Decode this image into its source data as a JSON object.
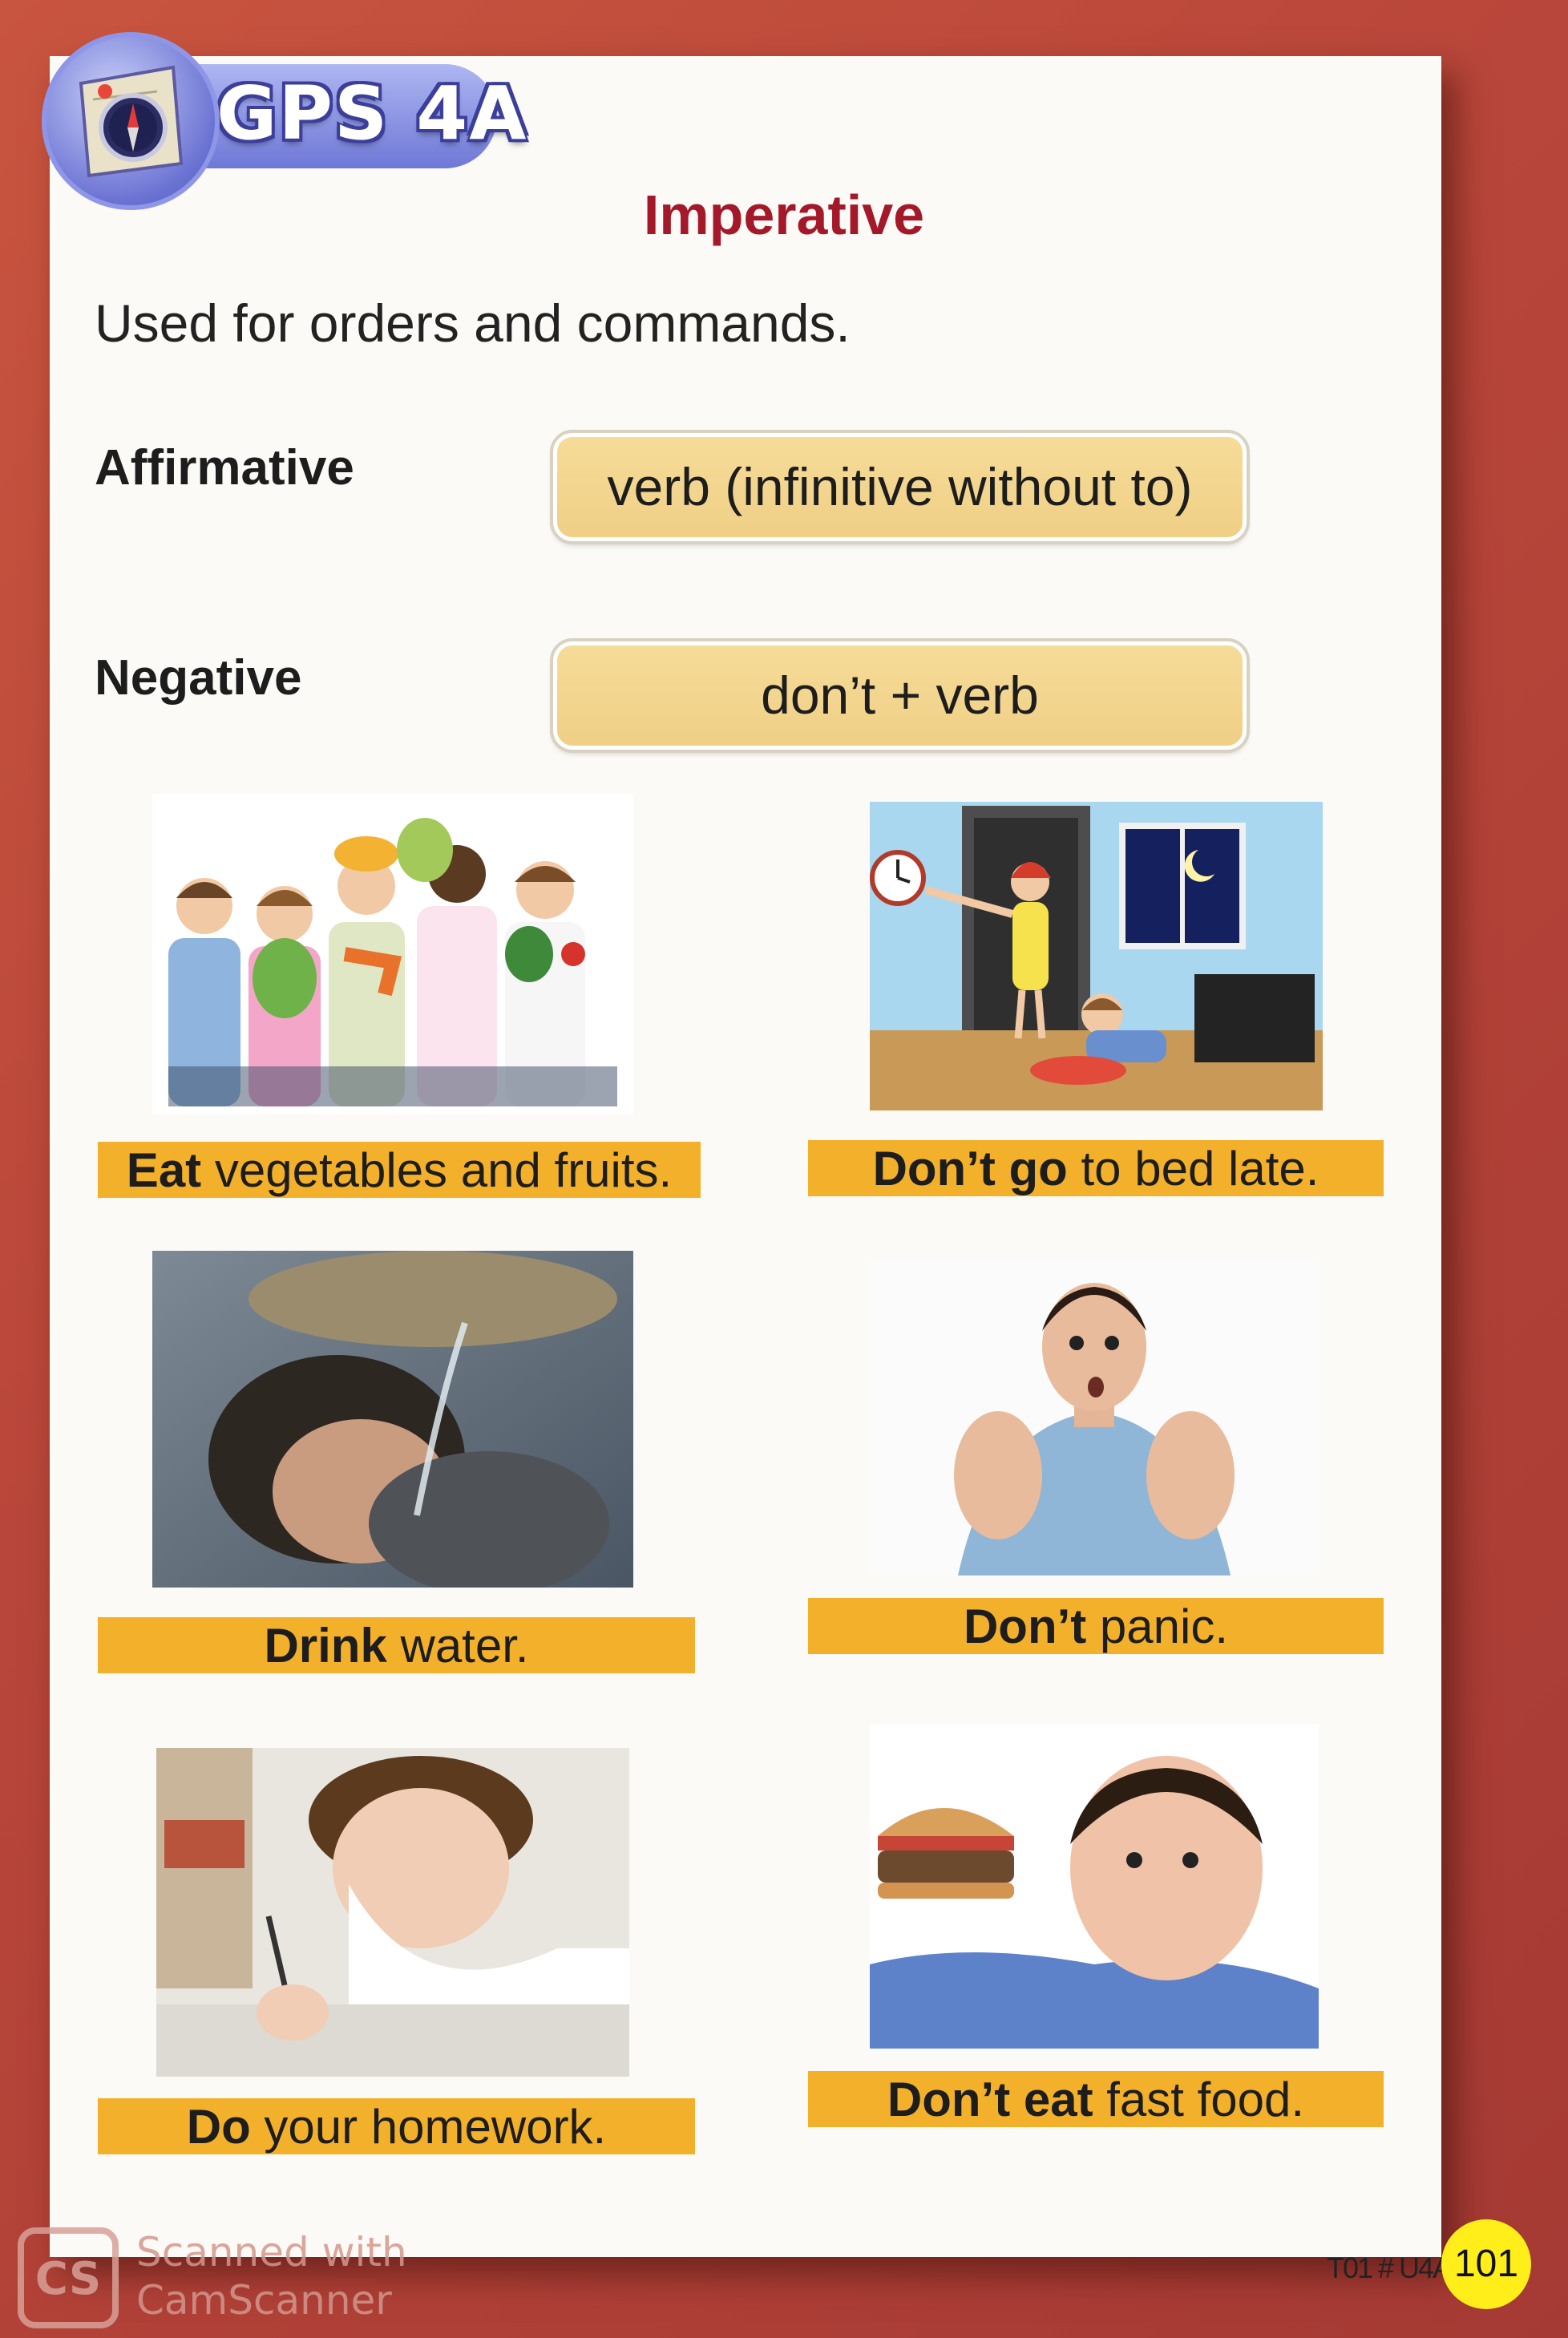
{
  "badge": {
    "text": "GPS 4A"
  },
  "title": "Imperative",
  "description": "Used for orders and commands.",
  "rules": [
    {
      "label": "Affirmative",
      "formula": "verb (infinitive without to)"
    },
    {
      "label": "Negative",
      "formula": "don’t + verb"
    }
  ],
  "examples": [
    {
      "bold": "Eat",
      "rest": " vegetables and fruits.",
      "image": "children-holding-vegetables"
    },
    {
      "bold": "Don’t go",
      "rest": " to bed late.",
      "image": "mother-pointing-to-bed"
    },
    {
      "bold": "Drink",
      "rest": " water.",
      "image": "boy-drinking-water"
    },
    {
      "bold": "Don’t",
      "rest": " panic.",
      "image": "panicked-man"
    },
    {
      "bold": "Do",
      "rest": " your homework.",
      "image": "boy-doing-homework"
    },
    {
      "bold": "Don’t eat",
      "rest": " fast food.",
      "image": "man-looking-at-burger"
    }
  ],
  "footer": {
    "code": "T01 # U4A",
    "page_number": "101"
  },
  "watermark": {
    "logo": "CS",
    "line1": "Scanned with",
    "line2": "CamScanner"
  }
}
